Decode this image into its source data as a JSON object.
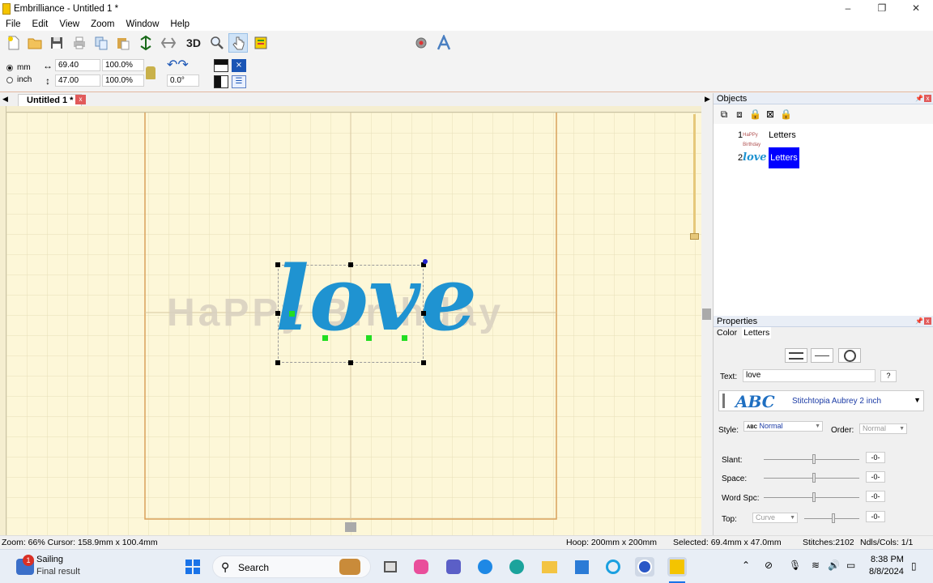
{
  "window": {
    "title": "Embrilliance -  Untitled 1 *",
    "minimize": "–",
    "maximize": "❐",
    "close": "✕"
  },
  "menu": [
    "File",
    "Edit",
    "View",
    "Zoom",
    "Window",
    "Help"
  ],
  "toolbar": {
    "three_d_label": "3D"
  },
  "props_row": {
    "unit_mm": "mm",
    "unit_inch": "inch",
    "width": "69.40",
    "height": "47.00",
    "width_pct": "100.0%",
    "height_pct": "100.0%",
    "rotation": "0.0°"
  },
  "document_tab": {
    "label": "Untitled 1 *",
    "close": "x"
  },
  "canvas": {
    "background_text": "HaPPy Birthday",
    "design_text": "love",
    "design_color": "#1f93d1"
  },
  "objects_panel": {
    "title": "Objects",
    "items": [
      {
        "index": "1",
        "label": "Letters",
        "selected": false
      },
      {
        "index": "2",
        "label": "Letters",
        "selected": true
      }
    ]
  },
  "properties_panel": {
    "title": "Properties",
    "tabs": [
      "Color",
      "Letters"
    ],
    "text_label": "Text:",
    "text_value": "love",
    "help": "?",
    "font_preview": "ABC",
    "font_name": "Stitchtopia Aubrey 2 inch",
    "style_label": "Style:",
    "style_value": "Normal",
    "style_prefix": "ABC",
    "order_label": "Order:",
    "order_value": "Normal",
    "slant_label": "Slant:",
    "slant_value": "-0-",
    "space_label": "Space:",
    "space_value": "-0-",
    "wordspc_label": "Word Spc:",
    "wordspc_value": "-0-",
    "top_label": "Top:",
    "top_combo": "Curve",
    "top_value": "-0-"
  },
  "status": {
    "zoom_cursor": "Zoom: 66%  Cursor: 158.9mm x 100.4mm",
    "hoop": "Hoop: 200mm x 200mm",
    "selected": "Selected: 69.4mm x 47.0mm",
    "stitches": "Stitches:2102",
    "ndls": "Ndls/Cols: 1/1"
  },
  "taskbar": {
    "notification_badge": "1",
    "weather_title": "Sailing",
    "weather_sub": "Final result",
    "search_placeholder": "Search",
    "time": "8:38 PM",
    "date": "8/8/2024"
  }
}
